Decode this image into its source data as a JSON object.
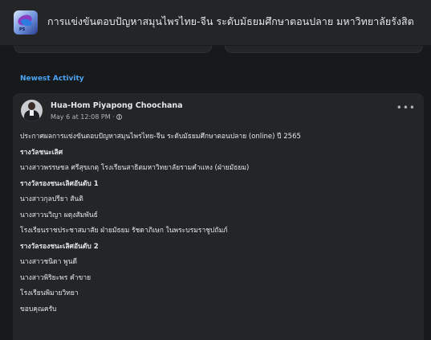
{
  "group": {
    "title": "การแข่งขันตอบปัญหาสมุนไพรไทย-จีน ระดับมัธยมศึกษาตอนปลาย มหาวิทยาลัยรังสิต",
    "thumb_tag": "PS"
  },
  "section": {
    "label": "Newest Activity"
  },
  "post": {
    "author": "Hua-Hom Piyapong Choochana",
    "timestamp": "May 6 at 12:08 PM ·",
    "privacy_icon": "globe-icon",
    "more_icon": "more-dots-icon",
    "more_label": "•••",
    "lines": [
      {
        "text": "ประกาศผลการแข่งขันตอบปัญหาสมุนไพรไทย-จีน ระดับมัธยมศึกษาตอนปลาย (online) ปี 2565",
        "bold": false
      },
      {
        "text": "รางวัลชนะเลิศ",
        "bold": true
      },
      {
        "text": "นางสาวพรรษชล ศรีสุขเกตุ โรงเรียนสาธิตมหาวิทยาลัยรามคำแหง (ฝ่ายมัธยม)",
        "bold": false
      },
      {
        "text": "รางวัลรองชนะเลิศอันดับ 1",
        "bold": true
      },
      {
        "text": "นางสาวกุลปรียา สันติ",
        "bold": false
      },
      {
        "text": "นางสาวนวิญา ผดุงสัมพันธ์",
        "bold": false
      },
      {
        "text": "โรงเรียนราชประชาสมาสัย ฝ่ายมัธยม รัชดาภิเษก ในพระบรมราชูปถัมภ์",
        "bold": false
      },
      {
        "text": "รางวัลรองชนะเลิศอันดับ 2",
        "bold": true
      },
      {
        "text": "นางสาวชนิดา พูนดี",
        "bold": false
      },
      {
        "text": "นางสาวพิริยะพร คำขาย",
        "bold": false
      },
      {
        "text": "โรงเรียนพิมายวิทยา",
        "bold": false
      },
      {
        "text": "ขอบคุณครับ",
        "bold": false
      }
    ]
  },
  "colors": {
    "background": "#18191a",
    "card": "#242526",
    "accent": "#4aa3f3",
    "text_primary": "#e4e6eb",
    "text_secondary": "#b0b3b8"
  }
}
